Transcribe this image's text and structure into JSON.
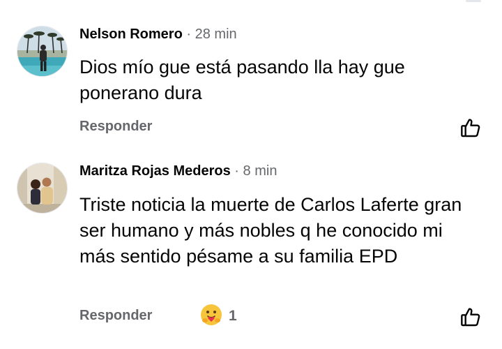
{
  "comments": [
    {
      "author": "Nelson Romero",
      "separator": "·",
      "time": "28 min",
      "text": "Dios mío gue está pasando lla hay gue ponerano dura",
      "reply_label": "Responder",
      "like_icon": "thumbs-up-outline"
    },
    {
      "author": "Maritza Rojas Mederos",
      "separator": "·",
      "time": "8 min",
      "text": "Triste noticia la muerte de Carlos Laferte gran ser humano y más nobles q he conocido mi más sentido pésame a su familia EPD",
      "reply_label": "Responder",
      "reaction_icon": "care-hug-emoji",
      "reaction_count": "1",
      "like_icon": "thumbs-up-outline"
    }
  ],
  "colors": {
    "text_primary": "#050505",
    "text_secondary": "#65676b",
    "divider": "#e4e6eb"
  }
}
